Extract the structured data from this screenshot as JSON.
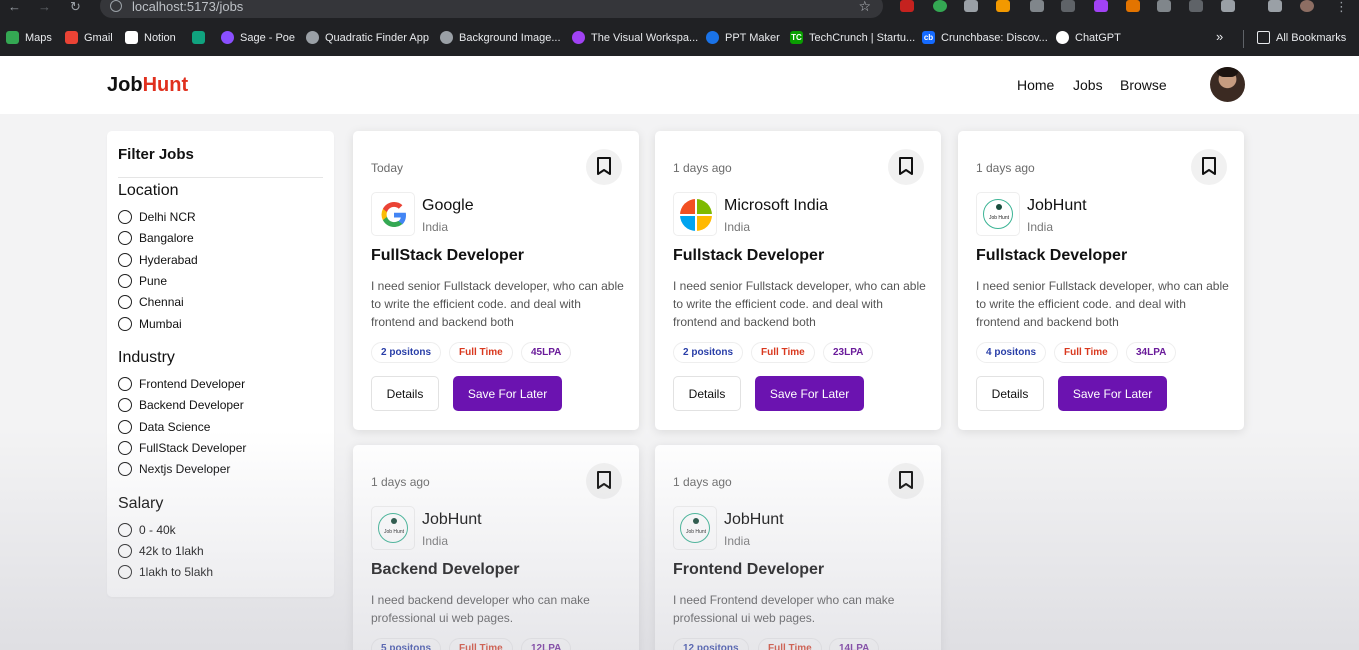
{
  "browser": {
    "url": "localhost:5173/jobs",
    "bookmarks": [
      {
        "label": "Maps",
        "icon": "maps-icon"
      },
      {
        "label": "Gmail",
        "icon": "gmail-icon"
      },
      {
        "label": "Notion",
        "icon": "notion-icon"
      },
      {
        "label": "",
        "icon": "chatgpt-green-icon"
      },
      {
        "label": "Sage - Poe",
        "icon": "poe-icon"
      },
      {
        "label": "Quadratic Finder App",
        "icon": "globe-icon"
      },
      {
        "label": "Background Image...",
        "icon": "globe-icon"
      },
      {
        "label": "The Visual Workspa...",
        "icon": "visual-workspace-icon"
      },
      {
        "label": "PPT Maker",
        "icon": "ppt-icon"
      },
      {
        "label": "TechCrunch | Startu...",
        "icon": "techcrunch-icon"
      },
      {
        "label": "Crunchbase: Discov...",
        "icon": "crunchbase-icon"
      },
      {
        "label": "ChatGPT",
        "icon": "chatgpt-icon"
      }
    ],
    "all_bookmarks": "All Bookmarks",
    "tc_icon_text": "TC",
    "cb_icon_text": "cb"
  },
  "header": {
    "logo_main": "Job",
    "logo_accent": "Hunt",
    "nav": [
      "Home",
      "Jobs",
      "Browse"
    ]
  },
  "filters": {
    "title": "Filter Jobs",
    "sections": [
      {
        "heading": "Location",
        "options": [
          "Delhi NCR",
          "Bangalore",
          "Hyderabad",
          "Pune",
          "Chennai",
          "Mumbai"
        ]
      },
      {
        "heading": "Industry",
        "options": [
          "Frontend Developer",
          "Backend Developer",
          "Data Science",
          "FullStack Developer",
          "Nextjs Developer"
        ]
      },
      {
        "heading": "Salary",
        "options": [
          "0 - 40k",
          "42k to 1lakh",
          "1lakh to 5lakh"
        ]
      }
    ]
  },
  "jobs": [
    {
      "date": "Today",
      "company": "Google",
      "location": "India",
      "logo": "google-logo",
      "title": "FullStack Developer",
      "description": "I need senior Fullstack developer, who can able to write the efficient code. and deal with frontend and backend both",
      "positions": "2 positons",
      "type": "Full Time",
      "salary": "45LPA"
    },
    {
      "date": "1 days ago",
      "company": "Microsoft India",
      "location": "India",
      "logo": "microsoft-logo",
      "title": "Fullstack Developer",
      "description": "I need senior Fullstack developer, who can able to write the efficient code. and deal with frontend and backend both",
      "positions": "2 positons",
      "type": "Full Time",
      "salary": "23LPA"
    },
    {
      "date": "1 days ago",
      "company": "JobHunt",
      "location": "India",
      "logo": "jobhunt-logo",
      "title": "Fullstack Developer",
      "description": "I need senior Fullstack developer, who can able to write the efficient code. and deal with frontend and backend both",
      "positions": "4 positons",
      "type": "Full Time",
      "salary": "34LPA"
    },
    {
      "date": "1 days ago",
      "company": "JobHunt",
      "location": "India",
      "logo": "jobhunt-logo",
      "title": "Backend Developer",
      "description": "I need backend developer who can make professional ui web pages.",
      "positions": "5 positons",
      "type": "Full Time",
      "salary": "12LPA"
    },
    {
      "date": "1 days ago",
      "company": "JobHunt",
      "location": "India",
      "logo": "jobhunt-logo",
      "title": "Frontend Developer",
      "description": "I need Frontend developer who can make professional ui web pages.",
      "positions": "12 positons",
      "type": "Full Time",
      "salary": "14LPA"
    }
  ],
  "jobhunt_logo_text": "Job Hunt",
  "card_buttons": {
    "details": "Details",
    "save": "Save For Later"
  }
}
